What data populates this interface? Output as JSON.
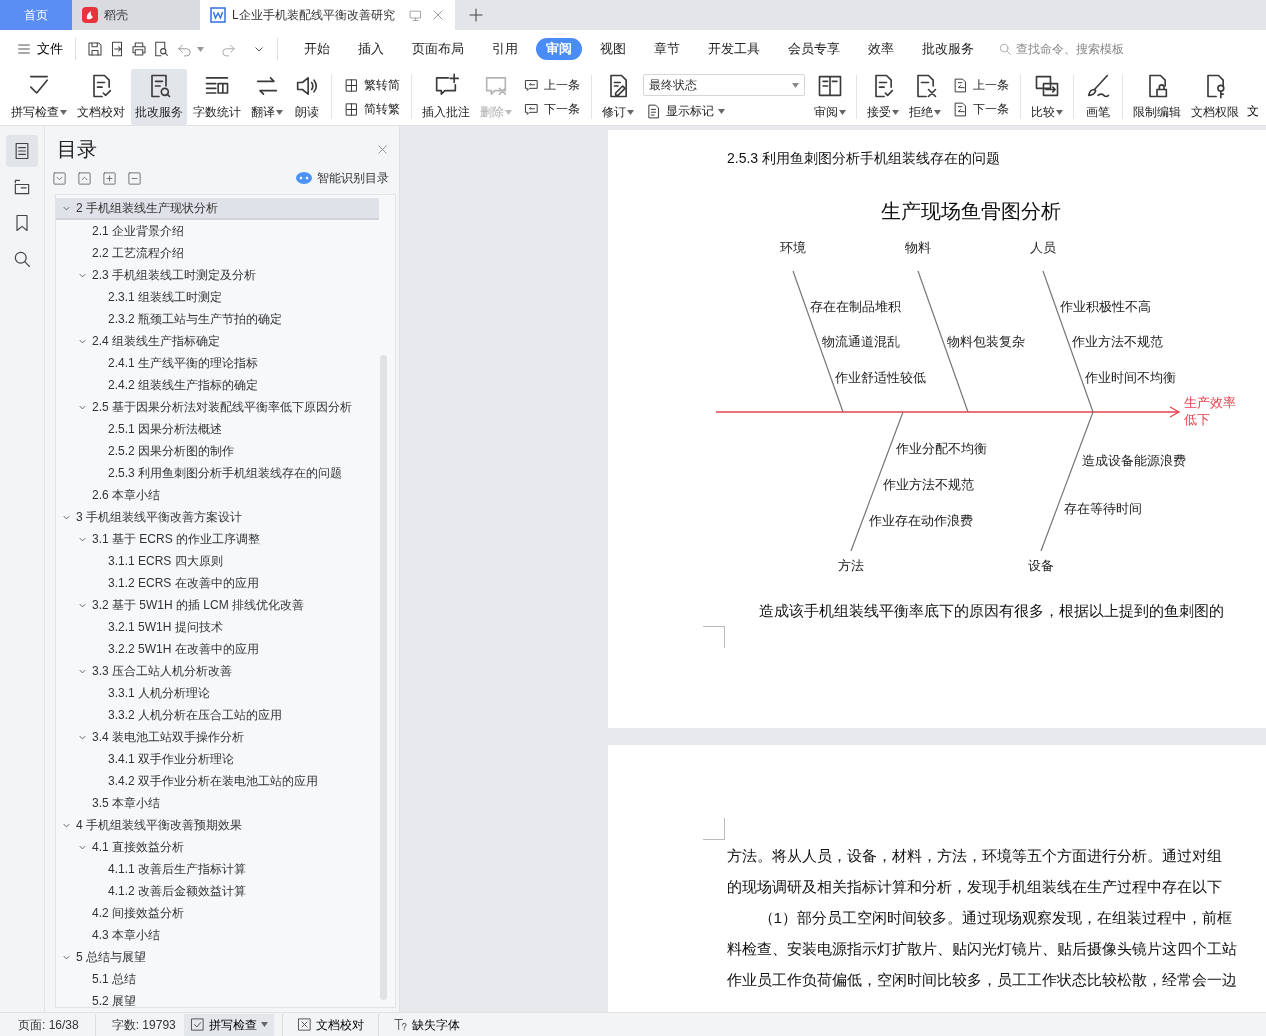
{
  "tabs": [
    {
      "kind": "home",
      "label": "首页",
      "selected": false
    },
    {
      "kind": "app",
      "label": "稻壳",
      "selected": false
    },
    {
      "kind": "document",
      "label": "L企业手机装配线平衡改善研究",
      "selected": true
    }
  ],
  "menu": {
    "file": "文件",
    "tabs": [
      {
        "label": "开始",
        "selected": false
      },
      {
        "label": "插入",
        "selected": false
      },
      {
        "label": "页面布局",
        "selected": false
      },
      {
        "label": "引用",
        "selected": false
      },
      {
        "label": "审阅",
        "selected": true
      },
      {
        "label": "视图",
        "selected": false
      },
      {
        "label": "章节",
        "selected": false
      },
      {
        "label": "开发工具",
        "selected": false
      },
      {
        "label": "会员专享",
        "selected": false
      },
      {
        "label": "效率",
        "selected": false
      },
      {
        "label": "批改服务",
        "selected": false
      }
    ],
    "search": {
      "placeholder": "查找命令、搜索模板"
    }
  },
  "ribbon": {
    "groups": [
      {
        "items": [
          {
            "kind": "large",
            "label": "拼写检查",
            "dropdown": true,
            "pressed": false,
            "disabled": false
          },
          {
            "kind": "large",
            "label": "文档校对",
            "dropdown": false,
            "pressed": false,
            "disabled": false
          },
          {
            "kind": "large",
            "label": "批改服务",
            "dropdown": false,
            "pressed": true,
            "disabled": false
          },
          {
            "kind": "large",
            "label": "字数统计",
            "dropdown": false,
            "pressed": false,
            "disabled": false
          },
          {
            "kind": "large",
            "label": "翻译",
            "dropdown": true,
            "pressed": false,
            "disabled": false
          },
          {
            "kind": "large",
            "label": "朗读",
            "dropdown": false,
            "pressed": false,
            "disabled": false
          }
        ]
      },
      {
        "items": [
          {
            "kind": "stack",
            "items": [
              {
                "kind": "small",
                "label": "繁转简",
                "dropdown": false
              },
              {
                "kind": "small",
                "label": "简转繁",
                "dropdown": false
              }
            ]
          }
        ]
      },
      {
        "items": [
          {
            "kind": "large",
            "label": "插入批注",
            "dropdown": false,
            "pressed": false,
            "disabled": false
          },
          {
            "kind": "large",
            "label": "删除",
            "dropdown": true,
            "pressed": false,
            "disabled": true
          },
          {
            "kind": "stack",
            "items": [
              {
                "kind": "small",
                "label": "上一条",
                "dropdown": false
              },
              {
                "kind": "small",
                "label": "下一条",
                "dropdown": false
              }
            ]
          }
        ]
      },
      {
        "items": [
          {
            "kind": "large",
            "label": "修订",
            "dropdown": true,
            "pressed": false,
            "disabled": false
          },
          {
            "kind": "stack",
            "items": [
              {
                "kind": "select",
                "value": "最终状态"
              },
              {
                "kind": "small",
                "label": "显示标记",
                "dropdown": true
              }
            ]
          },
          {
            "kind": "large",
            "label": "审阅",
            "dropdown": true,
            "pressed": false,
            "disabled": false
          }
        ]
      },
      {
        "items": [
          {
            "kind": "large",
            "label": "接受",
            "dropdown": true,
            "pressed": false,
            "disabled": false
          },
          {
            "kind": "large",
            "label": "拒绝",
            "dropdown": true,
            "pressed": false,
            "disabled": false
          },
          {
            "kind": "stack",
            "items": [
              {
                "kind": "small",
                "label": "上一条",
                "dropdown": false
              },
              {
                "kind": "small",
                "label": "下一条",
                "dropdown": false
              }
            ]
          }
        ]
      },
      {
        "items": [
          {
            "kind": "large",
            "label": "比较",
            "dropdown": true,
            "pressed": false,
            "disabled": false
          }
        ]
      },
      {
        "items": [
          {
            "kind": "large",
            "label": "画笔",
            "dropdown": false,
            "pressed": false,
            "disabled": false
          }
        ]
      },
      {
        "items": [
          {
            "kind": "large",
            "label": "限制编辑",
            "dropdown": false,
            "pressed": false,
            "disabled": false
          },
          {
            "kind": "large",
            "label": "文档权限",
            "dropdown": false,
            "pressed": false,
            "disabled": false
          },
          {
            "kind": "clipped",
            "label": "文"
          }
        ]
      }
    ]
  },
  "rail": [
    {
      "selected": true
    },
    {
      "selected": false
    },
    {
      "selected": false
    },
    {
      "selected": false
    }
  ],
  "toc": {
    "title": "目录",
    "smart_button": "智能识别目录",
    "items": [
      {
        "label": "2  手机组装线生产现状分析",
        "selected": true,
        "expanded": true,
        "children": [
          {
            "label": "2.1  企业背景介绍",
            "selected": false
          },
          {
            "label": "2.2  工艺流程介绍",
            "selected": false
          },
          {
            "label": "2.3 手机组装线工时测定及分析",
            "selected": false,
            "expanded": true,
            "children": [
              {
                "label": "2.3.1  组装线工时测定",
                "selected": false
              },
              {
                "label": "2.3.2  瓶颈工站与生产节拍的确定",
                "selected": false
              }
            ]
          },
          {
            "label": "2.4  组装线生产指标确定",
            "selected": false,
            "expanded": true,
            "children": [
              {
                "label": "2.4.1  生产线平衡的理论指标",
                "selected": false
              },
              {
                "label": "2.4.2  组装线生产指标的确定",
                "selected": false
              }
            ]
          },
          {
            "label": "2.5  基于因果分析法对装配线平衡率低下原因分析",
            "selected": false,
            "expanded": true,
            "children": [
              {
                "label": "2.5.1  因果分析法概述",
                "selected": false
              },
              {
                "label": "2.5.2 因果分析图的制作",
                "selected": false
              },
              {
                "label": "2.5.3  利用鱼刺图分析手机组装线存在的问题",
                "selected": false
              }
            ]
          },
          {
            "label": "2.6  本章小结",
            "selected": false
          }
        ]
      },
      {
        "label": "3  手机组装线平衡改善方案设计",
        "selected": false,
        "expanded": true,
        "children": [
          {
            "label": "3.1  基于 ECRS 的作业工序调整",
            "selected": false,
            "expanded": true,
            "children": [
              {
                "label": "3.1.1 ECRS  四大原则",
                "selected": false
              },
              {
                "label": "3.1.2 ECRS  在改善中的应用",
                "selected": false
              }
            ]
          },
          {
            "label": "3.2  基于 5W1H 的插 LCM 排线优化改善",
            "selected": false,
            "expanded": true,
            "children": [
              {
                "label": "3.2.1 5W1H  提问技术",
                "selected": false
              },
              {
                "label": "3.2.2 5W1H  在改善中的应用",
                "selected": false
              }
            ]
          },
          {
            "label": "3.3  压合工站人机分析改善",
            "selected": false,
            "expanded": true,
            "children": [
              {
                "label": "3.3.1  人机分析理论",
                "selected": false
              },
              {
                "label": "3.3.2  人机分析在压合工站的应用",
                "selected": false
              }
            ]
          },
          {
            "label": "3.4  装电池工站双手操作分析",
            "selected": false,
            "expanded": true,
            "children": [
              {
                "label": "3.4.1  双手作业分析理论",
                "selected": false
              },
              {
                "label": "3.4.2  双手作业分析在装电池工站的应用",
                "selected": false
              }
            ]
          },
          {
            "label": "3.5  本章小结",
            "selected": false
          }
        ]
      },
      {
        "label": "4  手机组装线平衡改善预期效果",
        "selected": false,
        "expanded": true,
        "children": [
          {
            "label": "4.1  直接效益分析",
            "selected": false,
            "expanded": true,
            "children": [
              {
                "label": "4.1.1  改善后生产指标计算",
                "selected": false
              },
              {
                "label": "4.1.2  改善后金额效益计算",
                "selected": false
              }
            ]
          },
          {
            "label": "4.2  间接效益分析",
            "selected": false
          },
          {
            "label": "4.3  本章小结",
            "selected": false
          }
        ]
      },
      {
        "label": "5  总结与展望",
        "selected": false,
        "expanded": true,
        "children": [
          {
            "label": "5.1 总结",
            "selected": false
          },
          {
            "label": "5.2  展望",
            "selected": false
          }
        ]
      }
    ]
  },
  "document": {
    "pages": [
      {
        "heading": "2.5.3  利用鱼刺图分析手机组装线存在的问题",
        "figure": {
          "title": "生产现场鱼骨图分析",
          "effect": "生产效率低下",
          "branches": [
            {
              "kind": "top",
              "label": "环境",
              "causes": [
                "存在在制品堆积",
                "物流通道混乱",
                "作业舒适性较低"
              ]
            },
            {
              "kind": "top",
              "label": "物料",
              "causes": [
                "物料包装复杂"
              ]
            },
            {
              "kind": "top",
              "label": "人员",
              "causes": [
                "作业积极性不高",
                "作业方法不规范",
                "作业时间不均衡"
              ]
            },
            {
              "kind": "bottom",
              "label": "方法",
              "causes": [
                "作业分配不均衡",
                "作业方法不规范",
                "作业存在动作浪费"
              ]
            },
            {
              "kind": "bottom",
              "label": "设备",
              "causes": [
                "造成设备能源浪费",
                "存在等待时间"
              ]
            }
          ]
        },
        "paragraphs": [
          {
            "indent": true,
            "lines": [
              "造成该手机组装线平衡率底下的原因有很多，根据以上提到的鱼刺图的"
            ]
          }
        ]
      },
      {
        "paragraphs": [
          {
            "indent": false,
            "lines": [
              "方法。将从人员，设备，材料，方法，环境等五个方面进行分析。通过对组",
              "的现场调研及相关指标计算和分析，发现手机组装线在生产过程中存在以下"
            ]
          },
          {
            "indent": true,
            "lines": [
              "（1）部分员工空闲时间较多。通过现场观察发现，在组装过程中，前框",
              "料检查、安装电源指示灯扩散片、贴闪光灯镜片、贴后摄像头镜片这四个工站",
              "作业员工作负荷偏低，空闲时间比较多，员工工作状态比较松散，经常会一边"
            ]
          }
        ]
      }
    ]
  },
  "status_bar": {
    "page": "页面: 16/38",
    "words": "字数: 19793",
    "buttons": [
      {
        "label": "拼写检查",
        "dropdown": true,
        "pressed": true
      },
      {
        "label": "文档校对",
        "dropdown": false,
        "pressed": false
      },
      {
        "label": "缺失字体",
        "dropdown": false,
        "pressed": false
      }
    ]
  }
}
